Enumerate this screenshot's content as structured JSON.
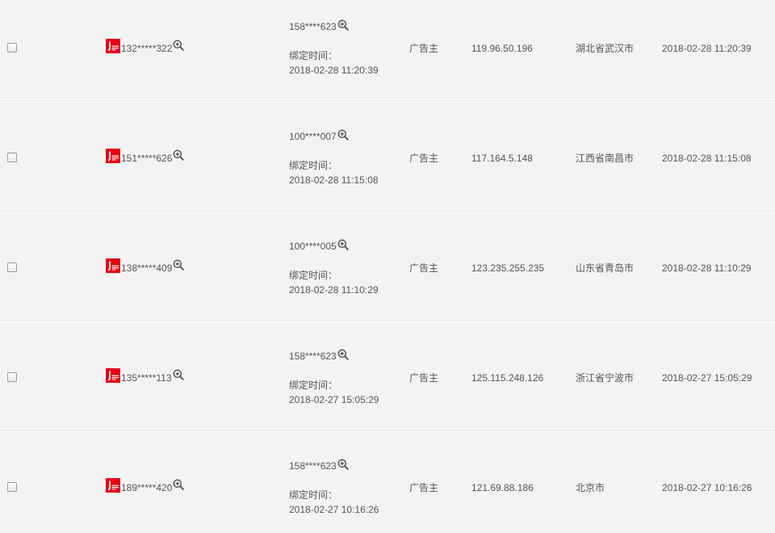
{
  "theme": {
    "accent": "#e60012",
    "text": "#555555",
    "background": "#f3f3f3",
    "separator": "#e5e5e5"
  },
  "icons": {
    "zoom": "zoom-in-icon",
    "logo": "brand-logo-icon"
  },
  "labels": {
    "bind_time": "绑定时间："
  },
  "rows": [
    {
      "phone": "132*****322",
      "account": "158****623",
      "bind_time": "2018-02-28 11:20:39",
      "role": "广告主",
      "ip": "119.96.50.196",
      "location": "湖北省武汉市",
      "time": "2018-02-28 11:20:39"
    },
    {
      "phone": "151*****626",
      "account": "100****007",
      "bind_time": "2018-02-28 11:15:08",
      "role": "广告主",
      "ip": "117.164.5.148",
      "location": "江西省南昌市",
      "time": "2018-02-28 11:15:08"
    },
    {
      "phone": "138*****409",
      "account": "100****005",
      "bind_time": "2018-02-28 11:10:29",
      "role": "广告主",
      "ip": "123.235.255.235",
      "location": "山东省青岛市",
      "time": "2018-02-28 11:10:29"
    },
    {
      "phone": "135*****113",
      "account": "158****623",
      "bind_time": "2018-02-27 15:05:29",
      "role": "广告主",
      "ip": "125.115.248.126",
      "location": "浙江省宁波市",
      "time": "2018-02-27 15:05:29"
    },
    {
      "phone": "189*****420",
      "account": "158****623",
      "bind_time": "2018-02-27 10:16:26",
      "role": "广告主",
      "ip": "121.69.88.186",
      "location": "北京市",
      "time": "2018-02-27 10:16:26"
    }
  ]
}
